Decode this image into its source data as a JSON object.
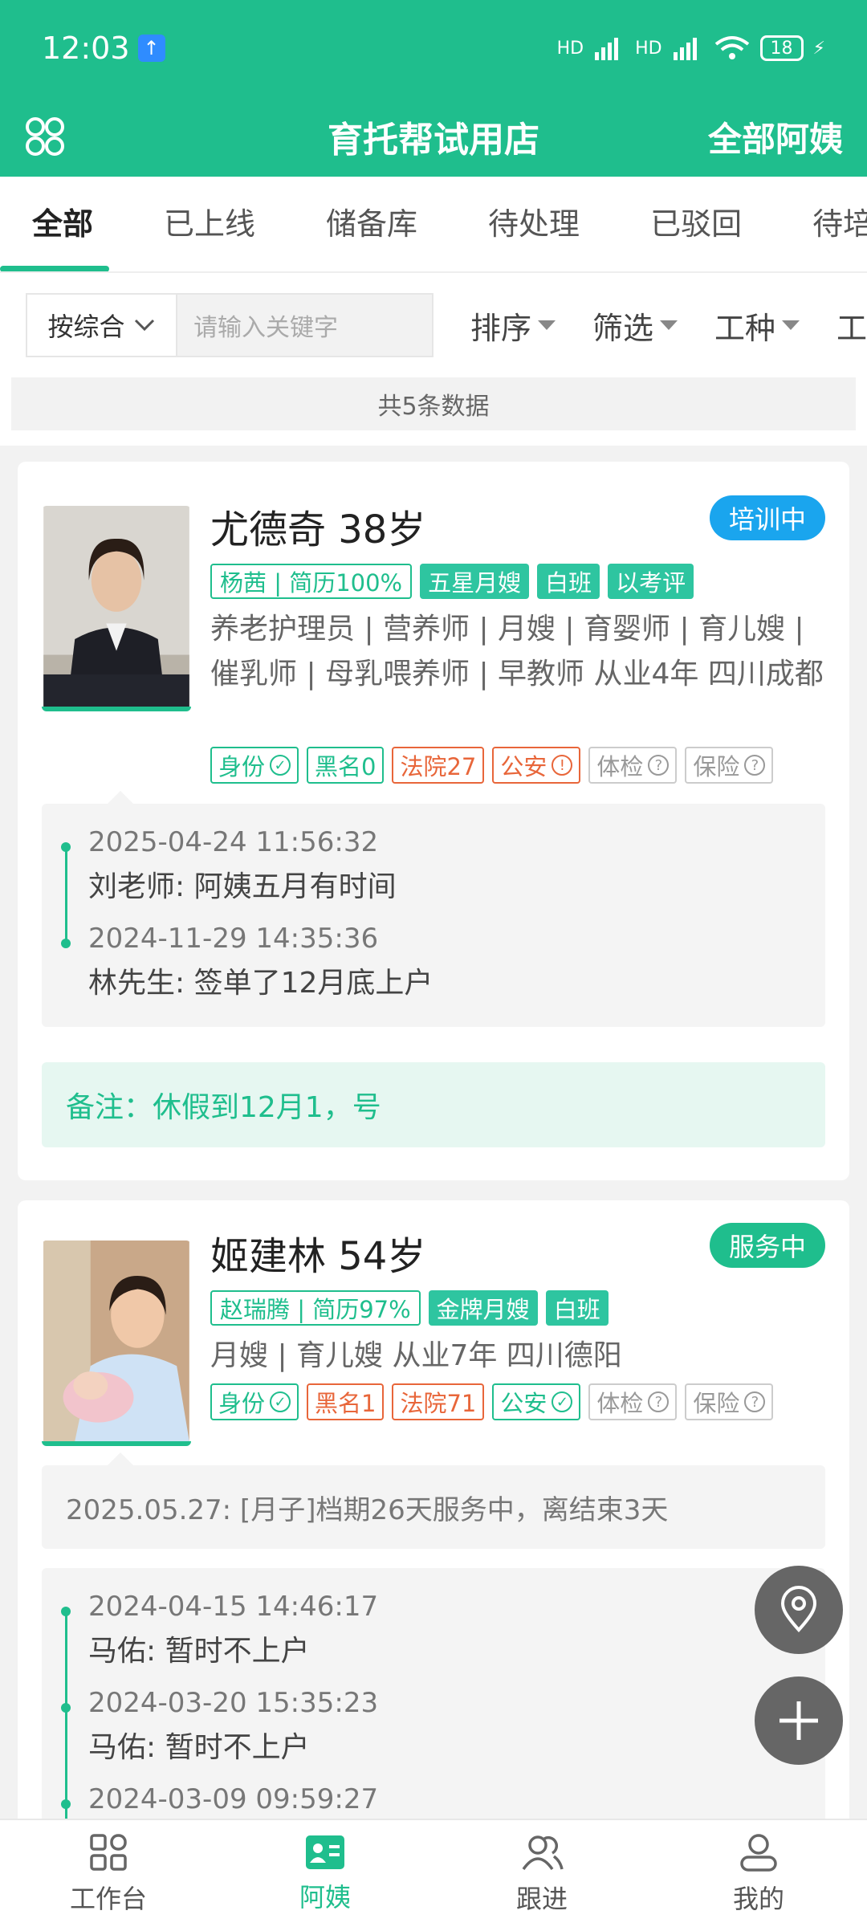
{
  "status_bar": {
    "time": "12:03",
    "battery": "18",
    "signal": "HD"
  },
  "header": {
    "title": "育托帮试用店",
    "right_label": "全部阿姨",
    "menu_icon": "grid-icon"
  },
  "tabs": [
    "全部",
    "已上线",
    "储备库",
    "待处理",
    "已驳回",
    "待培训"
  ],
  "search": {
    "select_label": "按综合",
    "placeholder": "请输入关键字",
    "filters": [
      "排序",
      "筛选",
      "工种",
      "工"
    ]
  },
  "count_text": "共5条数据",
  "colors": {
    "brand": "#1fbe8d",
    "training": "#1aa5ee",
    "serving": "#1fbe8d",
    "warn": "#e8663a"
  },
  "cards": [
    {
      "name": "尤德奇 38岁",
      "status": "培训中",
      "tags_outline": [
        "杨茜 | 简历100%"
      ],
      "tags_fill": [
        "五星月嫂",
        "白班",
        "以考评"
      ],
      "desc": "养老护理员 | 营养师 | 月嫂 | 育婴师 | 育儿嫂 | 催乳师 | 母乳喂养师 | 早教师 从业4年 四川成都",
      "badges": [
        "身份",
        "黑名0",
        "法院27",
        "公安",
        "体检",
        "保险"
      ],
      "follow": [
        {
          "date": "2025-04-24 11:56:32",
          "text": "刘老师: 阿姨五月有时间"
        },
        {
          "date": "2024-11-29 14:35:36",
          "text": "林先生: 签单了12月底上户"
        }
      ],
      "note": "备注：休假到12月1，号"
    },
    {
      "name": "姬建林 54岁",
      "status": "服务中",
      "tags_outline": [
        "赵瑞腾 | 简历97%"
      ],
      "tags_fill": [
        "金牌月嫂",
        "白班"
      ],
      "desc": "月嫂 | 育儿嫂 从业7年 四川德阳",
      "badges": [
        "身份",
        "黑名1",
        "法院71",
        "公安",
        "体检",
        "保险"
      ],
      "schedule": "2025.05.27: [月子]档期26天服务中，离结束3天",
      "follow": [
        {
          "date": "2024-04-15 14:46:17",
          "text": "马佑: 暂时不上户"
        },
        {
          "date": "2024-03-20 15:35:23",
          "text": "马佑: 暂时不上户"
        },
        {
          "date": "2024-03-09 09:59:27",
          "text": ""
        }
      ]
    }
  ],
  "bottom_nav": [
    "工作台",
    "阿姨",
    "跟进",
    "我的"
  ]
}
